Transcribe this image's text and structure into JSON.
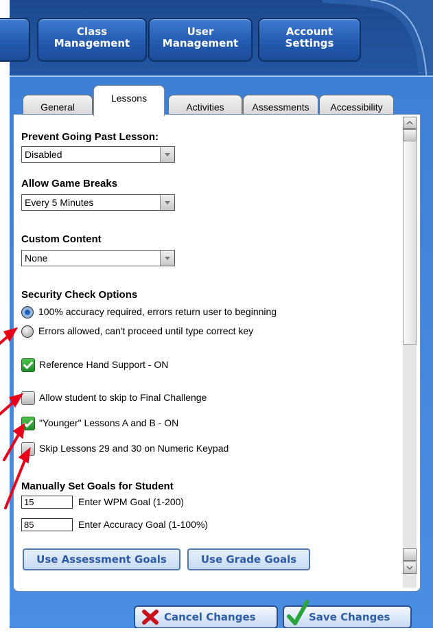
{
  "nav": {
    "class_management": [
      "Class",
      "Management"
    ],
    "user_management": [
      "User",
      "Management"
    ],
    "account_settings": [
      "Account",
      "Settings"
    ]
  },
  "tabs": [
    "General",
    "Lessons",
    "Activities",
    "Assessments",
    "Accessibility"
  ],
  "active_tab": "Lessons",
  "settings": {
    "prevent_going_past": {
      "label": "Prevent Going Past Lesson:",
      "value": "Disabled"
    },
    "game_breaks": {
      "label": "Allow Game Breaks",
      "value": "Every 5 Minutes"
    },
    "custom_content": {
      "label": "Custom Content",
      "value": "None"
    },
    "security": {
      "label": "Security Check Options",
      "options": [
        {
          "text": "100% accuracy required, errors return user to beginning",
          "selected": true
        },
        {
          "text": "Errors allowed, can't proceed until type correct key",
          "selected": false
        }
      ]
    },
    "checkboxes": [
      {
        "text": "Reference Hand Support - ON",
        "checked": true
      },
      {
        "text": "Allow student to skip to Final Challenge",
        "checked": false
      },
      {
        "text": "\"Younger\" Lessons A and B - ON",
        "checked": true
      },
      {
        "text": "Skip Lessons 29 and 30 on Numeric Keypad",
        "checked": false
      }
    ],
    "goals": {
      "label": "Manually Set Goals for Student",
      "wpm_value": "15",
      "wpm_text": "Enter WPM Goal (1-200)",
      "accuracy_value": "85",
      "accuracy_text": "Enter Accuracy Goal (1-100%)"
    },
    "use_assessment_goals": "Use Assessment Goals",
    "use_grade_goals": "Use Grade Goals"
  },
  "footer": {
    "cancel": "Cancel Changes",
    "save": "Save Changes"
  },
  "colors": {
    "navy": "#1d4a8e",
    "panel": "#4b8fe2",
    "annotation_arrow": "#e8001a",
    "check_green": "#2aa33a"
  },
  "icons": [
    "cancel-x-icon",
    "save-check-icon",
    "radio-selected-icon",
    "checkbox-icon",
    "dropdown-arrow-icon"
  ]
}
